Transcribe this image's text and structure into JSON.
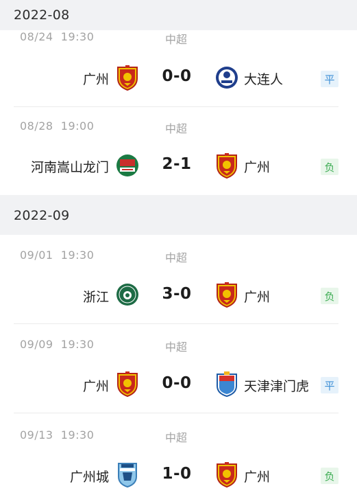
{
  "months": [
    {
      "label": "2022-08",
      "matches": [
        {
          "date": "08/24",
          "time": "19:30",
          "league": "中超",
          "home": "广州",
          "home_icon": "guangzhou-crest-icon",
          "score": "0-0",
          "away": "大连人",
          "away_icon": "dalian-crest-icon",
          "result": "平",
          "result_type": "draw"
        },
        {
          "date": "08/28",
          "time": "19:00",
          "league": "中超",
          "home": "河南嵩山龙门",
          "home_icon": "henan-crest-icon",
          "score": "2-1",
          "away": "广州",
          "away_icon": "guangzhou-crest-icon",
          "result": "负",
          "result_type": "loss"
        }
      ]
    },
    {
      "label": "2022-09",
      "matches": [
        {
          "date": "09/01",
          "time": "19:30",
          "league": "中超",
          "home": "浙江",
          "home_icon": "zhejiang-crest-icon",
          "score": "3-0",
          "away": "广州",
          "away_icon": "guangzhou-crest-icon",
          "result": "负",
          "result_type": "loss"
        },
        {
          "date": "09/09",
          "time": "19:30",
          "league": "中超",
          "home": "广州",
          "home_icon": "guangzhou-crest-icon",
          "score": "0-0",
          "away": "天津津门虎",
          "away_icon": "tianjin-crest-icon",
          "result": "平",
          "result_type": "draw"
        },
        {
          "date": "09/13",
          "time": "19:30",
          "league": "中超",
          "home": "广州城",
          "home_icon": "guangzhou-city-crest-icon",
          "score": "1-0",
          "away": "广州",
          "away_icon": "guangzhou-crest-icon",
          "result": "负",
          "result_type": "loss"
        }
      ]
    }
  ],
  "colors": {
    "draw": "#3e8fd6",
    "loss": "#3fad55",
    "background": "#f1f2f4"
  }
}
